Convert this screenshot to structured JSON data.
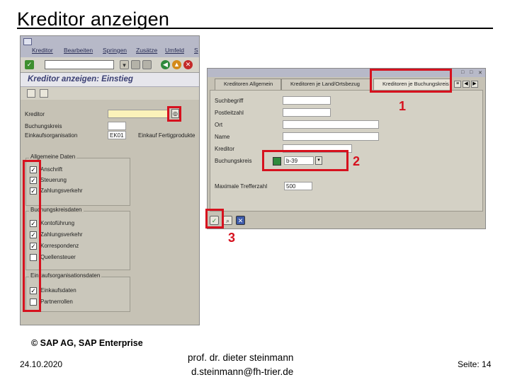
{
  "slide": {
    "title": "Kreditor anzeigen",
    "copyright": "© SAP AG, SAP Enterprise",
    "date": "24.10.2020",
    "author_line1": "prof. dr. dieter steinmann",
    "author_line2": "d.steinmann@fh-trier.de",
    "page": "Seite: 14"
  },
  "left_window": {
    "menu": [
      "Kreditor",
      "Bearbeiten",
      "Springen",
      "Zusätze",
      "Umfeld",
      "S"
    ],
    "header_title": "Kreditor anzeigen: Einstieg",
    "fields": [
      {
        "label": "Kreditor",
        "value": ""
      },
      {
        "label": "Buchungskreis",
        "value": ""
      },
      {
        "label": "Einkaufsorganisation",
        "value": "EK01",
        "desc": "Einkauf Fertigprodukte"
      }
    ],
    "groups": [
      {
        "title": "Allgemeine Daten",
        "items": [
          {
            "label": "Anschrift",
            "checked": true
          },
          {
            "label": "Steuerung",
            "checked": true
          },
          {
            "label": "Zahlungsverkehr",
            "checked": true
          }
        ]
      },
      {
        "title": "Buchungskreisdaten",
        "items": [
          {
            "label": "Kontoführung",
            "checked": true
          },
          {
            "label": "Zahlungsverkehr",
            "checked": true
          },
          {
            "label": "Korrespondenz",
            "checked": true
          },
          {
            "label": "Quellensteuer",
            "checked": false
          }
        ]
      },
      {
        "title": "Einkaufsorganisationsdaten",
        "items": [
          {
            "label": "Einkaufsdaten",
            "checked": true
          },
          {
            "label": "Partnerrollen",
            "checked": false
          }
        ]
      }
    ]
  },
  "right_window": {
    "tabs": [
      "Kreditoren Allgemein",
      "Kreditoren je Land/Ortsbezug",
      "Kreditoren je Buchungskreis"
    ],
    "fields": [
      {
        "label": "Suchbegriff",
        "value": ""
      },
      {
        "label": "Postleitzahl",
        "value": ""
      },
      {
        "label": "Ort",
        "value": ""
      },
      {
        "label": "Name",
        "value": ""
      },
      {
        "label": "Kreditor",
        "value": ""
      },
      {
        "label": "Buchungskreis",
        "value": "b-39"
      },
      {
        "label": "Maximale Trefferzahl",
        "value": "500"
      }
    ]
  },
  "markers": [
    "1",
    "2",
    "3"
  ],
  "colors": {
    "highlight": "#d6111e",
    "sap_bg": "#c6c2b5",
    "title_blue": "#3a3f73"
  }
}
